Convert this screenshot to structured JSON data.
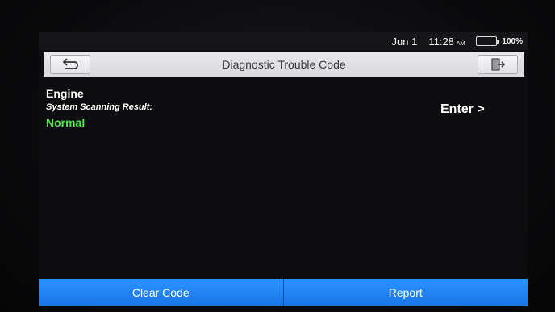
{
  "status_bar": {
    "date": "Jun 1",
    "time": "11:28",
    "ampm": "AM",
    "battery_percent": "100%",
    "battery_level": 1.0,
    "battery_color": "#2fe04a"
  },
  "title_bar": {
    "title": "Diagnostic Trouble Code",
    "back_icon": "back-arrow-icon",
    "exit_icon": "exit-door-icon"
  },
  "content": {
    "system_name": "Engine",
    "scan_label": "System Scanning Result:",
    "scan_value": "Normal",
    "scan_value_color": "#4ee94e",
    "enter_label": "Enter >"
  },
  "actions": {
    "clear_code_label": "Clear Code",
    "report_label": "Report",
    "button_color": "#1a74e6"
  }
}
